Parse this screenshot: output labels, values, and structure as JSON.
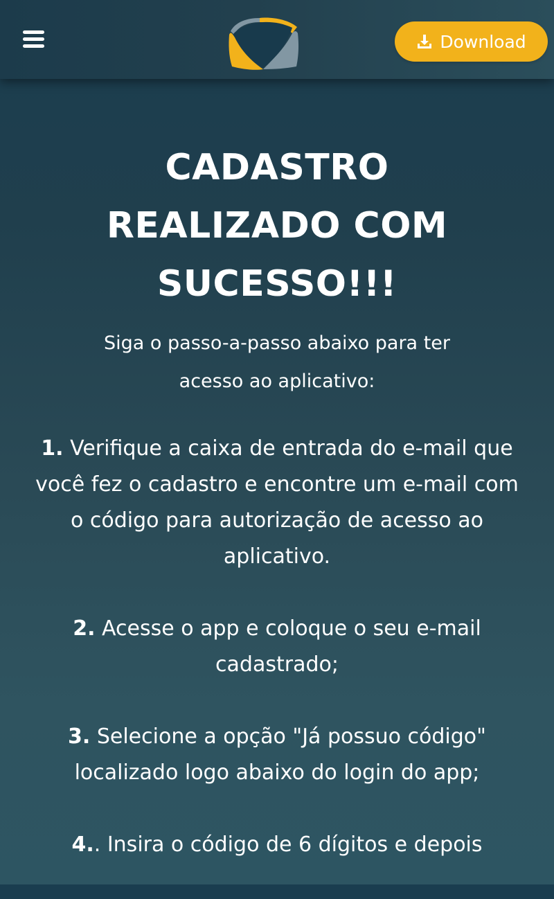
{
  "header": {
    "menu_icon": "hamburger-menu-icon",
    "logo_icon": "brand-logo-icon",
    "download_icon": "download-icon",
    "download_label": "Download",
    "colors": {
      "accent": "#f2b21b",
      "logo_dark": "#183a4c",
      "logo_gray": "#8297a3"
    }
  },
  "main": {
    "title": "CADASTRO REALIZADO COM SUCESSO!!!",
    "intro": "Siga o passo-a-passo abaixo para ter acesso ao aplicativo:",
    "steps": [
      {
        "number": "1.",
        "text": "Verifique a caixa de entrada do e-mail que você fez o cadastro e encontre um e-mail com o código para autorização de acesso ao aplicativo."
      },
      {
        "number": "2.",
        "text": "Acesse o app e coloque o seu e-mail cadastrado;"
      },
      {
        "number": "3.",
        "text": "Selecione a opção \"Já possuo código\" localizado logo abaixo do login do app;"
      },
      {
        "number": "4.",
        "text": ". Insira o código de 6 dígitos e depois"
      }
    ]
  }
}
